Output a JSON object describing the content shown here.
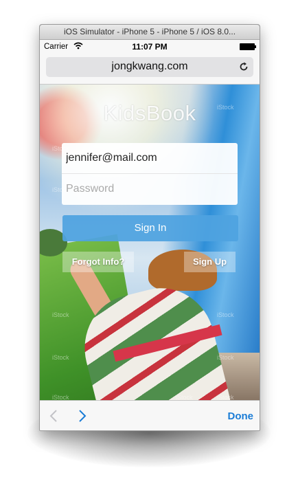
{
  "window": {
    "title": "iOS Simulator - iPhone 5 - iPhone 5 / iOS 8.0..."
  },
  "status_bar": {
    "carrier": "Carrier",
    "time": "11:07 PM"
  },
  "address_bar": {
    "url": "jongkwang.com"
  },
  "page": {
    "logo": "KidsBook",
    "email_value": "jennifer@mail.com",
    "password_placeholder": "Password",
    "signin_label": "Sign In",
    "forgot_label": "Forgot Info?",
    "signup_label": "Sign Up",
    "watermark": "iStock"
  },
  "toolbar": {
    "done_label": "Done"
  },
  "colors": {
    "accent": "#1a7cd6",
    "signin_button": "#4fa3e0"
  },
  "icons": [
    "wifi-icon",
    "battery-icon",
    "reload-icon",
    "back-arrow-icon",
    "forward-arrow-icon"
  ]
}
